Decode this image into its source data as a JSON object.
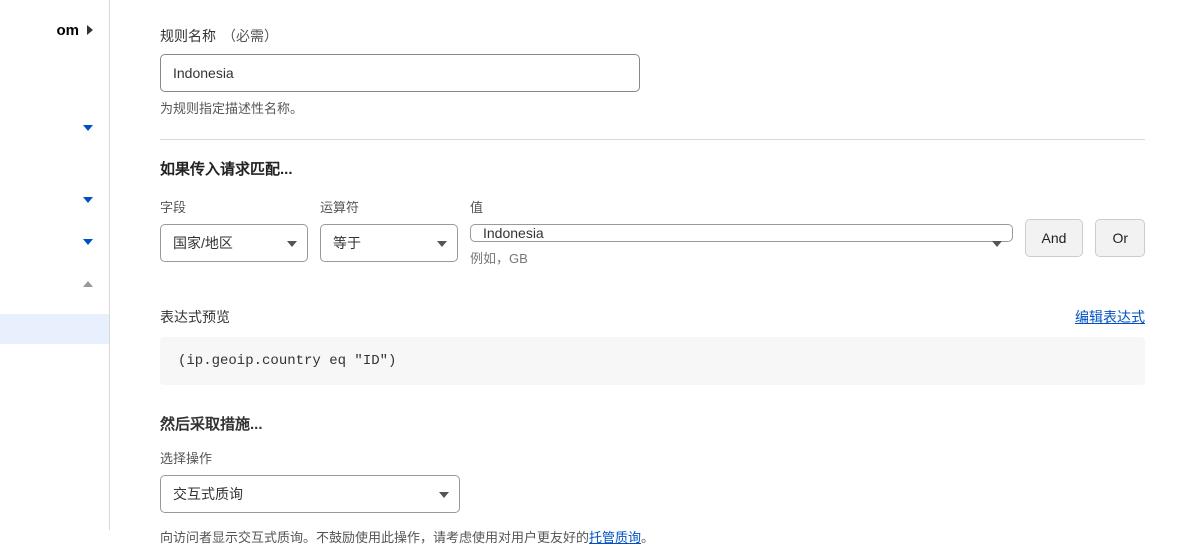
{
  "sidebar": {
    "partial_domain": "om"
  },
  "rule_name": {
    "label": "规则名称",
    "required": "（必需）",
    "value": "Indonesia",
    "help": "为规则指定描述性名称。"
  },
  "match_section": {
    "title": "如果传入请求匹配...",
    "field_label": "字段",
    "field_value": "国家/地区",
    "operator_label": "运算符",
    "operator_value": "等于",
    "value_label": "值",
    "value_value": "Indonesia",
    "value_example": "例如，GB",
    "and_button": "And",
    "or_button": "Or"
  },
  "preview": {
    "label": "表达式预览",
    "edit_link": "编辑表达式",
    "code": "(ip.geoip.country eq \"ID\")"
  },
  "action": {
    "title": "然后采取措施...",
    "select_label": "选择操作",
    "select_value": "交互式质询",
    "help_prefix": "向访问者显示交互式质询。不鼓励使用此操作，请考虑使用对用户更友好的",
    "help_link": "托管质询",
    "help_suffix": "。"
  }
}
